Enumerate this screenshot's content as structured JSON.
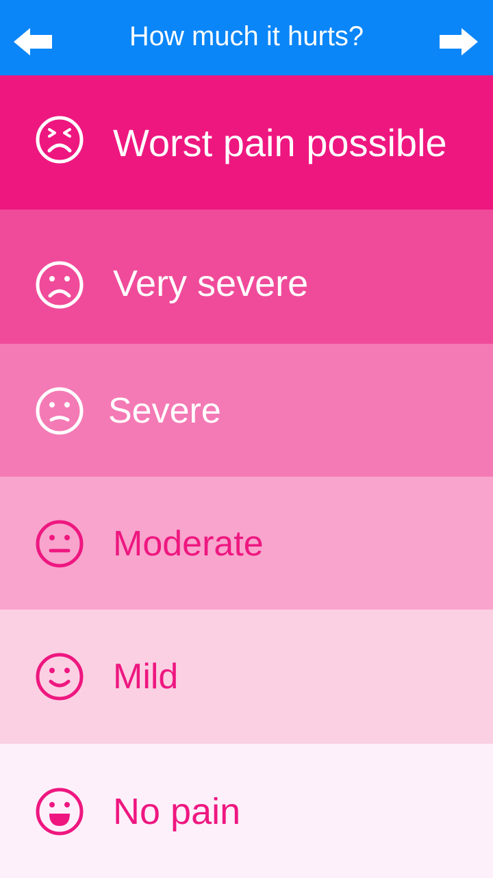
{
  "header": {
    "title": "How much it hurts?",
    "back_icon": "arrow-left-icon",
    "next_icon": "arrow-right-icon",
    "background": "#0a86f8"
  },
  "levels": [
    {
      "label": "Worst pain possible",
      "icon": "crying-face-icon",
      "bg": "#ee1780",
      "fg": "#ffffff"
    },
    {
      "label": "Very severe",
      "icon": "frowning-face-icon",
      "bg": "#f04b9a",
      "fg": "#ffffff"
    },
    {
      "label": "Severe",
      "icon": "slightly-frowning-face-icon",
      "bg": "#f47ab5",
      "fg": "#ffffff"
    },
    {
      "label": "Moderate",
      "icon": "neutral-face-icon",
      "bg": "#f8a4cd",
      "fg": "#ee1780"
    },
    {
      "label": "Mild",
      "icon": "smiling-face-icon",
      "bg": "#fbd0e3",
      "fg": "#ee1780"
    },
    {
      "label": "No pain",
      "icon": "grinning-face-icon",
      "bg": "#fdf0fb",
      "fg": "#ee1780"
    }
  ]
}
